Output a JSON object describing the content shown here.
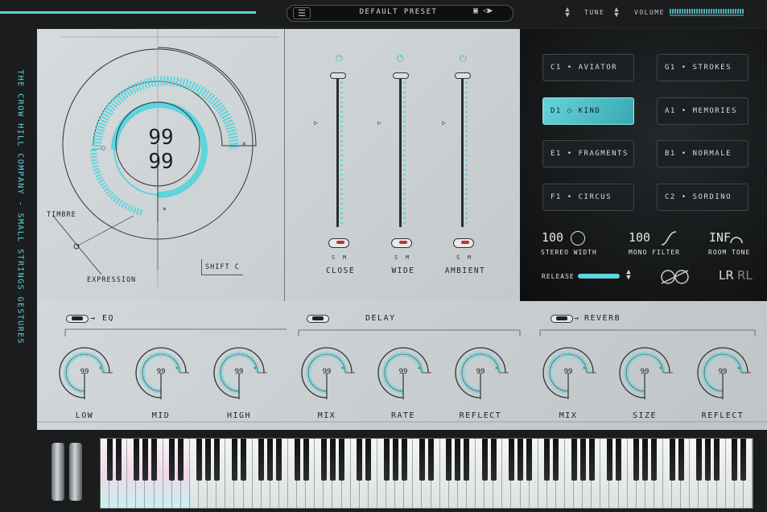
{
  "header": {
    "preset_name": "DEFAULT PRESET",
    "tune_label": "TUNE",
    "volume_label": "VOLUME",
    "menu_icon": "hamburger-icon",
    "save_icon": "save-icon"
  },
  "brand": {
    "text": "THE CROW HILL COMPANY  -  SMALL STRINGS GESTURES"
  },
  "dial": {
    "value1": "99",
    "value2": "99",
    "timbre_label": "TIMBRE",
    "expression_label": "EXPRESSION",
    "shift_label": "SHIFT  C"
  },
  "faders": [
    {
      "name": "CLOSE",
      "s": "S",
      "m": "M"
    },
    {
      "name": "WIDE",
      "s": "S",
      "m": "M"
    },
    {
      "name": "AMBIENT",
      "s": "S",
      "m": "M"
    }
  ],
  "articulations": [
    {
      "key": "C1",
      "name": "AVIATOR",
      "selected": false
    },
    {
      "key": "G1",
      "name": "STROKES",
      "selected": false
    },
    {
      "key": "D1",
      "name": "KIND",
      "selected": true
    },
    {
      "key": "A1",
      "name": "MEMORIES",
      "selected": false
    },
    {
      "key": "E1",
      "name": "FRAGMENTS",
      "selected": false
    },
    {
      "key": "B1",
      "name": "NORMALE",
      "selected": false
    },
    {
      "key": "F1",
      "name": "CIRCUS",
      "selected": false
    },
    {
      "key": "C2",
      "name": "SORDINO",
      "selected": false
    }
  ],
  "dark": {
    "stereo_val": "100",
    "stereo_lbl": "STEREO WIDTH",
    "mono_val": "100",
    "mono_lbl": "MONO FILTER",
    "room_val": "INF",
    "room_lbl": "ROOM TONE",
    "release_lbl": "RELEASE",
    "lr": "LR",
    "rl": "RL"
  },
  "sections": {
    "eq": "EQ",
    "delay": "DELAY",
    "reverb": "REVERB"
  },
  "knobs": [
    {
      "label": "LOW",
      "value": "99"
    },
    {
      "label": "MID",
      "value": "99"
    },
    {
      "label": "HIGH",
      "value": "99"
    },
    {
      "label": "MIX",
      "value": "99"
    },
    {
      "label": "RATE",
      "value": "99"
    },
    {
      "label": "REFLECT",
      "value": "99"
    },
    {
      "label": "MIX",
      "value": "99"
    },
    {
      "label": "SIZE",
      "value": "99"
    },
    {
      "label": "REFLECT",
      "value": "99"
    }
  ],
  "colors": {
    "accent": "#5fd4dc",
    "selected": "#58c7cf"
  }
}
